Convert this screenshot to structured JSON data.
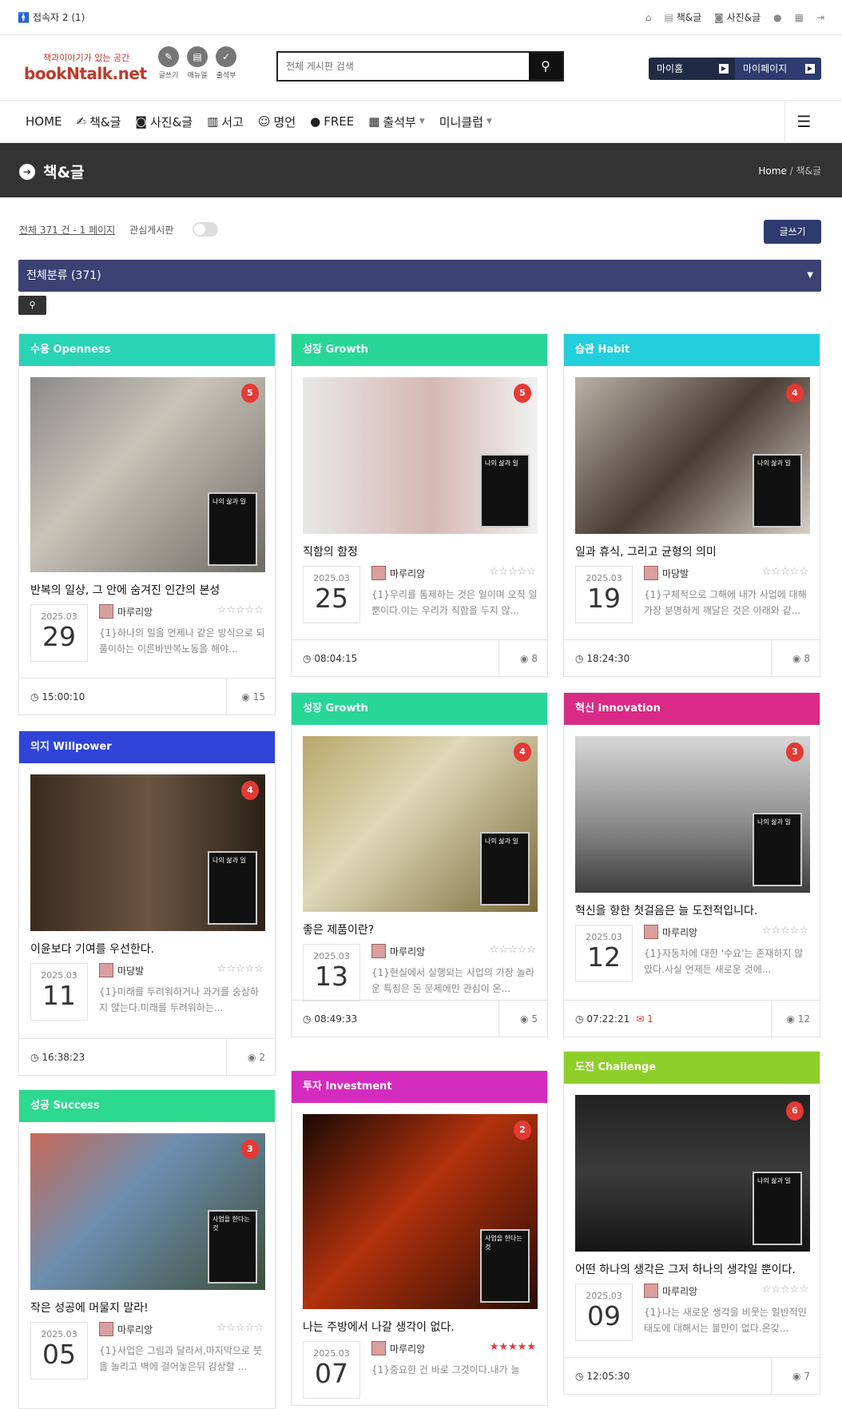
{
  "topbar": {
    "connected": "접속자 2 (1)",
    "links": [
      "책&글",
      "사진&글"
    ]
  },
  "logo": {
    "tagline": "책과이야기가 있는 공간",
    "brand": "bookNtalk.net"
  },
  "quick": [
    {
      "icon": "pencil-icon",
      "label": "글쓰기"
    },
    {
      "icon": "manual-icon",
      "label": "매뉴얼"
    },
    {
      "icon": "calendar-check-icon",
      "label": "출석부"
    }
  ],
  "search": {
    "placeholder": "전체 게시판 검색"
  },
  "my": {
    "home": "마이홈",
    "page": "마이페이지"
  },
  "nav": [
    "HOME",
    "책&글",
    "사진&글",
    "서고",
    "명언",
    "FREE",
    "출석부",
    "미니클럽"
  ],
  "banner": {
    "title": "책&글",
    "crumb_home": "Home",
    "crumb_sep": "/",
    "crumb_current": "책&글"
  },
  "list": {
    "total": "전체 371 건 - 1 페이지",
    "favorite": "관심게시판",
    "write": "글쓰기",
    "category": "전체분류 (371)"
  },
  "cards": [
    {
      "cat": "수용 Openness",
      "color": "#29d3b6",
      "badge": "5",
      "title": "반복의 일상, 그 안에 숨겨진 인간의 본성",
      "ym": "2025.03",
      "day": "29",
      "author": "마루리앙",
      "summary": "{1}하나의 일을 언제나 같은 방식으로 되풀이하는 이른바반복노동을 해야...",
      "time": "15:00:10",
      "views": "15",
      "stars": "☆☆☆☆☆",
      "book": "나의 삶과 일",
      "comments": ""
    },
    {
      "cat": "성장 Growth",
      "color": "#28d69a",
      "badge": "5",
      "title": "직함의 함정",
      "ym": "2025.03",
      "day": "25",
      "author": "마루리앙",
      "summary": "{1}우리를 통제하는 것은 일이며 오직 일뿐이다.이는 우리가 직함을 두지 않...",
      "time": "08:04:15",
      "views": "8",
      "stars": "☆☆☆☆☆",
      "book": "나의 삶과 일",
      "comments": ""
    },
    {
      "cat": "습관 Habit",
      "color": "#23cfdc",
      "badge": "4",
      "title": "일과 휴식, 그리고 균형의 의미",
      "ym": "2025.03",
      "day": "19",
      "author": "마당발",
      "summary": "{1}구체적으로 그해에 내가 사업에 대해 가장 분명하게 깨달은 것은 아래와 같...",
      "time": "18:24:30",
      "views": "8",
      "stars": "☆☆☆☆☆",
      "book": "나의 삶과 일",
      "comments": ""
    },
    {
      "cat": "의지 Willpower",
      "color": "#2f43d6",
      "badge": "4",
      "title": "이윤보다 기여를 우선한다.",
      "ym": "2025.03",
      "day": "11",
      "author": "마당발",
      "summary": "{1}미래를 두려워하거나 과거를 숭상하지 않는다.미래를 두려워하는...",
      "time": "16:38:23",
      "views": "2",
      "stars": "☆☆☆☆☆",
      "book": "나의 삶과 일",
      "comments": ""
    },
    {
      "cat": "성장 Growth",
      "color": "#28d69a",
      "badge": "4",
      "title": "좋은 제품이란?",
      "ym": "2025.03",
      "day": "13",
      "author": "마루리앙",
      "summary": "{1}현실에서 실행되는 사업의 가장 놀라운 특징은 돈 문제에만 관심이 온...",
      "time": "08:49:33",
      "views": "5",
      "stars": "☆☆☆☆☆",
      "book": "나의 삶과 일",
      "comments": ""
    },
    {
      "cat": "혁신 Innovation",
      "color": "#d92b86",
      "badge": "3",
      "title": "혁신을 향한 첫걸음은 늘 도전적입니다.",
      "ym": "2025.03",
      "day": "12",
      "author": "마루리앙",
      "summary": "{1}자동차에 대한 '수요'는 존재하지 않았다.사실 언제든 새로운 것에...",
      "time": "07:22:21",
      "views": "12",
      "stars": "☆☆☆☆☆",
      "book": "나의 삶과 일",
      "comments": "1"
    },
    {
      "cat": "성공 Success",
      "color": "#2dd88f",
      "badge": "3",
      "title": "작은 성공에 머물지 말라!",
      "ym": "2025.03",
      "day": "05",
      "author": "마루리앙",
      "summary": "{1}사업은 그림과 달라서,마지막으로 붓을 놀리고 벽에 걸어놓은뒤 감상할 ...",
      "time": "",
      "views": "",
      "stars": "☆☆☆☆☆",
      "book": "사업을 한다는것",
      "comments": ""
    },
    {
      "cat": "투자 Investment",
      "color": "#d42bbf",
      "badge": "2",
      "title": "나는 주방에서 나갈 생각이 없다.",
      "ym": "2025.03",
      "day": "07",
      "author": "마루리앙",
      "summary": "{1}중요한 건 바로 그것이다.내가 늘",
      "time": "",
      "views": "",
      "stars": "★★★★★",
      "book": "사업을 한다는것",
      "comments": ""
    },
    {
      "cat": "도전 Challenge",
      "color": "#8fcf2a",
      "badge": "6",
      "title": "어떤 하나의 생각은 그저 하나의 생각일 뿐이다.",
      "ym": "2025.03",
      "day": "09",
      "author": "마루리앙",
      "summary": "{1}나는 새로운 생각을 비웃는 일반적인 태도에 대해서는 불만이 없다.온갖...",
      "time": "12:05:30",
      "views": "7",
      "stars": "☆☆☆☆☆",
      "book": "나의 삶과 일",
      "comments": ""
    }
  ]
}
